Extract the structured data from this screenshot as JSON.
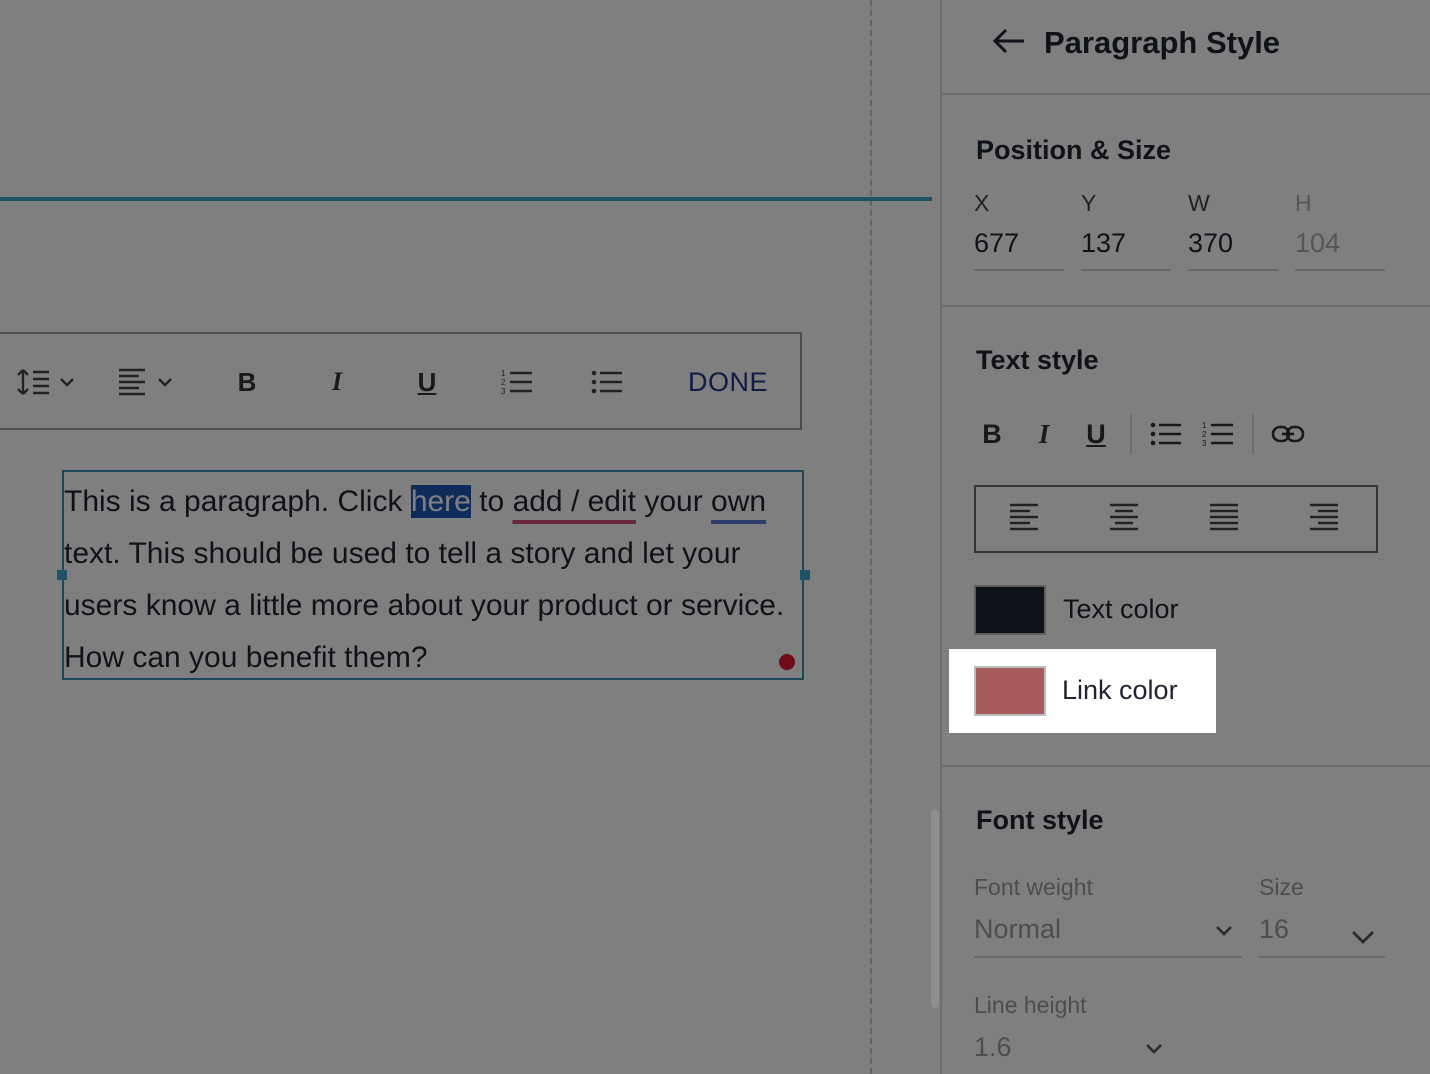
{
  "panel": {
    "title": "Paragraph Style",
    "back_icon": "arrow-left-icon"
  },
  "position_size": {
    "title": "Position & Size",
    "fields": [
      {
        "label": "X",
        "value": "677"
      },
      {
        "label": "Y",
        "value": "137"
      },
      {
        "label": "W",
        "value": "370"
      },
      {
        "label": "H",
        "value": "104"
      }
    ]
  },
  "text_style": {
    "title": "Text style",
    "buttons": [
      "B",
      "I",
      "U"
    ],
    "text_color_label": "Text color",
    "text_color": "#1a2230",
    "link_color_label": "Link color",
    "link_color": "#a85b5b"
  },
  "font_style": {
    "title": "Font style",
    "font_weight_label": "Font weight",
    "font_weight_value": "Normal",
    "size_label": "Size",
    "size_value": "16",
    "line_height_label": "Line height",
    "line_height_value": "1.6"
  },
  "toolbar": {
    "bold": "B",
    "italic": "I",
    "underline": "U",
    "done": "DONE"
  },
  "paragraph": {
    "part1": "This is a paragraph. Click ",
    "selected": "here",
    "part2": " to ",
    "link1": "add / edit",
    "part3": " your ",
    "link2": "own",
    "part4": " text. This should be used to tell a story and let your users know a little more about your product or service. How can you benefit them?"
  },
  "colors": {
    "accent": "#3aa6c9",
    "done": "#1e3a8a",
    "selection": "#1e56b6"
  }
}
